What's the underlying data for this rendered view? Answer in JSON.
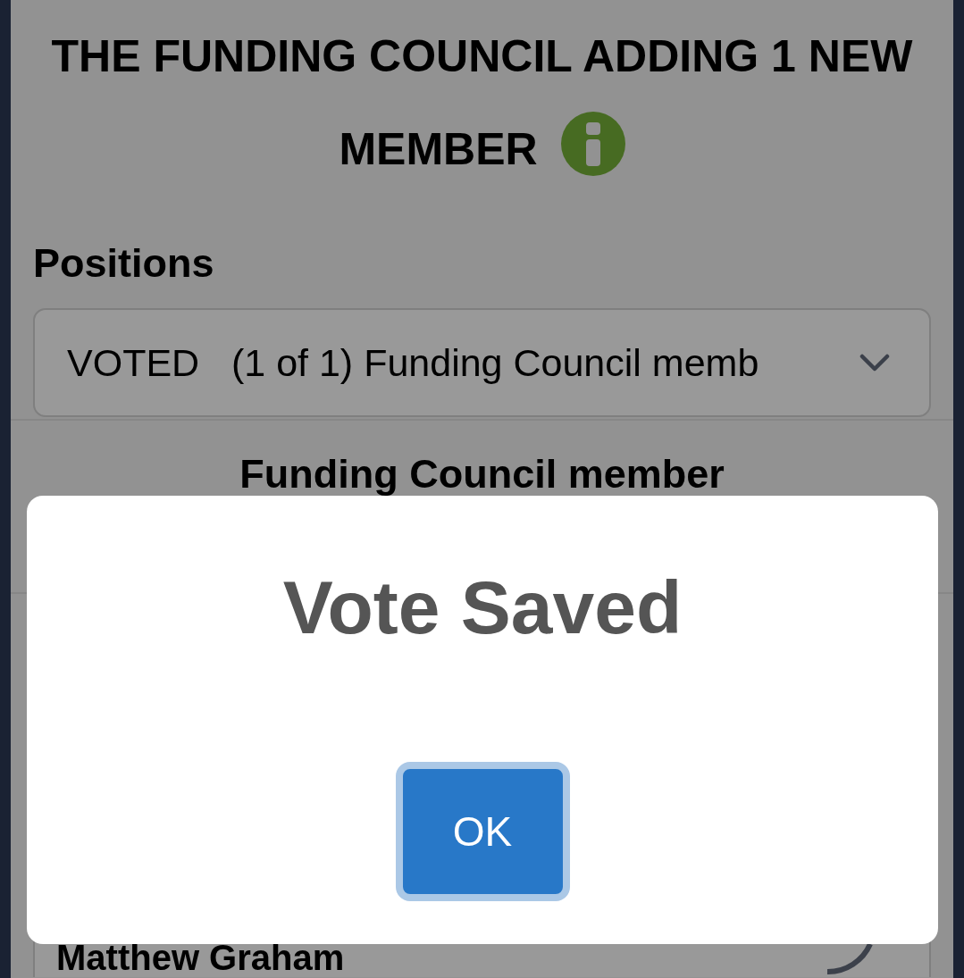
{
  "header": {
    "title_lines": [
      "THE FUNDING COUNCIL ADDING 1 NEW",
      "MEMBER"
    ]
  },
  "positions": {
    "label": "Positions",
    "select": {
      "value": "VOTED   (1 of 1) Funding Council memb"
    }
  },
  "section": {
    "title": "Funding Council member"
  },
  "candidates": [
    {
      "name": "Matthew Graham"
    }
  ],
  "dialog": {
    "title": "Vote Saved",
    "buttons": [
      "OK"
    ]
  }
}
